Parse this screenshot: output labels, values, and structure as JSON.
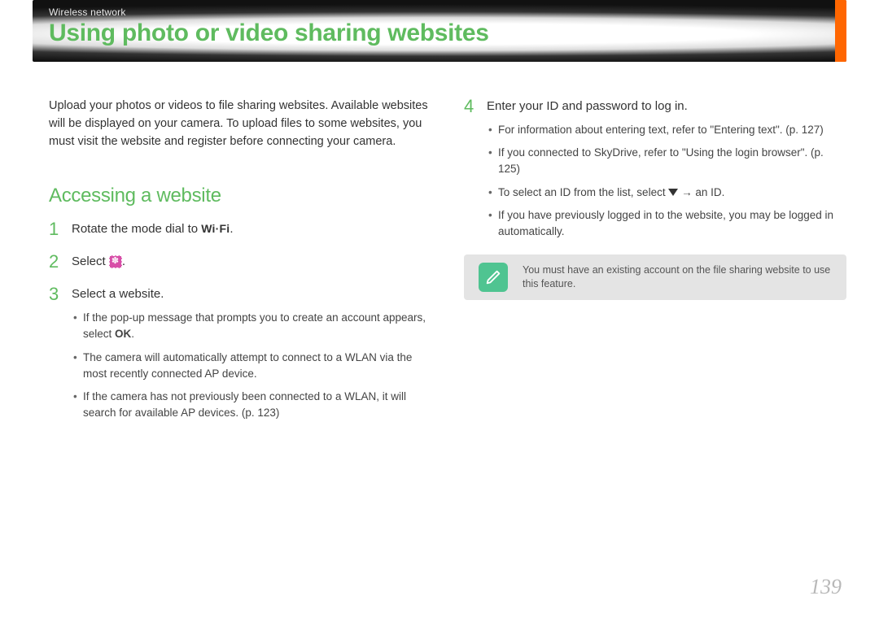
{
  "header": {
    "breadcrumb": "Wireless network",
    "title": "Using photo or video sharing websites"
  },
  "intro": "Upload your photos or videos to file sharing websites. Available websites will be displayed on your camera. To upload files to some websites, you must visit the website and register before connecting your camera.",
  "section_heading": "Accessing a website",
  "steps": {
    "s1": {
      "num": "1",
      "pre": "Rotate the mode dial to ",
      "badge": "Wi·Fi",
      "post": "."
    },
    "s2": {
      "num": "2",
      "pre": "Select ",
      "post": "."
    },
    "s3": {
      "num": "3",
      "text": "Select a website.",
      "sub1a": "If the pop-up message that prompts you to create an account appears, select ",
      "sub1b": "OK",
      "sub1c": ".",
      "sub2": "The camera will automatically attempt to connect to a WLAN via the most recently connected AP device.",
      "sub3": "If the camera has not previously been connected to a WLAN, it will search for available AP devices. (p. 123)"
    },
    "s4": {
      "num": "4",
      "text": "Enter your ID and password to log in.",
      "sub1": "For information about entering text, refer to \"Entering text\". (p. 127)",
      "sub2": "If you connected to SkyDrive, refer to \"Using the login browser\". (p. 125)",
      "sub3a": "To select an ID from the list, select ",
      "sub3b": " → an ID.",
      "sub4": "If you have previously logged in to the website, you may be logged in automatically."
    }
  },
  "note": "You must have an existing account on the file sharing website to use this feature.",
  "page_number": "139"
}
